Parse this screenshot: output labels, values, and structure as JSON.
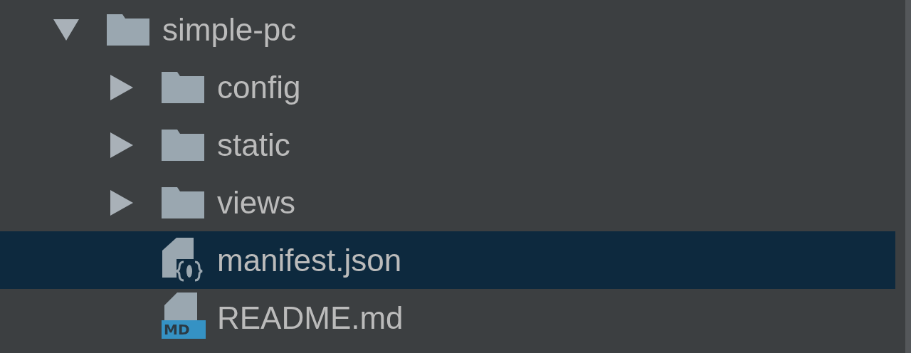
{
  "tree": [
    {
      "label": "simple-pc",
      "kind": "folder",
      "expanded": true,
      "selected": false,
      "children": [
        {
          "label": "config",
          "kind": "folder",
          "expanded": false,
          "selected": false
        },
        {
          "label": "static",
          "kind": "folder",
          "expanded": false,
          "selected": false
        },
        {
          "label": "views",
          "kind": "folder",
          "expanded": false,
          "selected": false
        },
        {
          "label": "manifest.json",
          "kind": "json",
          "selected": true
        },
        {
          "label": "README.md",
          "kind": "markdown",
          "badge": "MD",
          "selected": false
        }
      ]
    }
  ]
}
